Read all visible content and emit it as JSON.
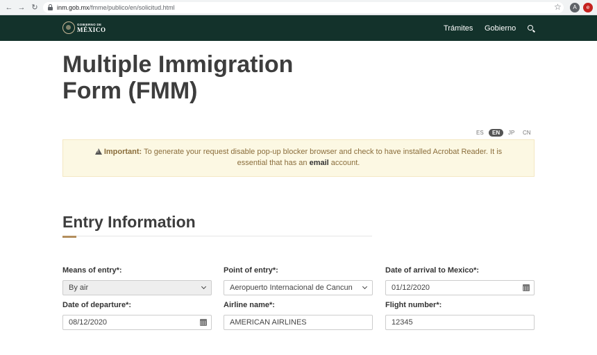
{
  "browser": {
    "url_domain": "inm.gob.mx",
    "url_path": "/fmme/publico/en/solicitud.html",
    "profile_initial": "A",
    "extension_initial": "e",
    "colors": {
      "profile": "#5f6368",
      "extension": "#c5221f"
    }
  },
  "header": {
    "logo_top": "GOBIERNO DE",
    "logo_bottom": "MÉXICO",
    "nav": [
      "Trámites",
      "Gobierno"
    ],
    "colors": {
      "background": "#13322b",
      "accent": "#b38e5d"
    }
  },
  "page": {
    "title": "Multiple Immigration Form (FMM)",
    "languages": [
      "ES",
      "EN",
      "JP",
      "CN"
    ],
    "active_language": "EN"
  },
  "alert": {
    "strong": "Important:",
    "text1": "To generate your request disable pop-up blocker browser and check to have installed Acrobat Reader. It is essential that has an",
    "email": "email",
    "text2": "account."
  },
  "section": {
    "title": "Entry Information"
  },
  "form": {
    "means_of_entry": {
      "label": "Means of entry*:",
      "value": "By air"
    },
    "point_of_entry": {
      "label": "Point of entry*:",
      "value": "Aeropuerto Internacional de Cancun"
    },
    "arrival_date": {
      "label": "Date of arrival to Mexico*:",
      "value": "01/12/2020"
    },
    "departure_date": {
      "label": "Date of departure*:",
      "value": "08/12/2020"
    },
    "airline": {
      "label": "Airline name*:",
      "value": "AMERICAN AIRLINES"
    },
    "flight": {
      "label": "Flight number*:",
      "value": "12345"
    }
  }
}
